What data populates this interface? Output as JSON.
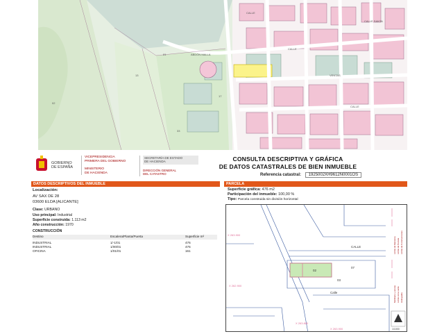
{
  "map": {
    "street_labels": [
      "CALLE",
      "CALLE",
      "CALLE",
      "ABDÓN MALLA",
      "CALLE",
      "CALLE",
      "CALLE",
      "VENTAS",
      "CALLE",
      "CALLE",
      "CALLE",
      "CALLE",
      "CALLE SANTA",
      "CALLE"
    ],
    "parcel_numbers": [
      "02",
      "01",
      "13",
      "17",
      "33",
      "20",
      "83",
      "22",
      "07",
      "15",
      "01",
      "12",
      "10",
      "05",
      "06"
    ],
    "colors": {
      "urban": "#f0c6d6",
      "rustic": "#d7e8cd",
      "building": "#c8dcd4",
      "highlight": "#fbf38a",
      "road": "#ffffff",
      "border": "#8a5a8a"
    }
  },
  "header": {
    "logo_text": [
      "GOBIERNO",
      "DE ESPAÑA"
    ],
    "ministry_1": [
      "VICEPRESIDENCIA",
      "PRIMERA DEL GOBIERNO"
    ],
    "ministry_2": [
      "MINISTERIO",
      "DE HACIENDA"
    ],
    "secretaria_1": [
      "SECRETARÍA DE ESTADO",
      "DE HACIENDA"
    ],
    "secretaria_2": [
      "DIRECCIÓN GENERAL",
      "DEL CATASTRO"
    ],
    "title_line_1": "CONSULTA DESCRIPTIVA Y GRÁFICA",
    "title_line_2": "DE DATOS CATASTRALES DE BIEN INMUEBLE",
    "ref_label": "Referencia catastral:",
    "ref_value": "1925002XH9612N0001OS"
  },
  "left_section": {
    "bar_title": "DATOS DESCRIPTIVOS DEL INMUEBLE",
    "localizacion_label": "Localización:",
    "address_1": "AV SAX DE 28",
    "address_2": "03600 ELDA [ALICANTE]",
    "clase_label": "Clase:",
    "clase_value": "URBANO",
    "uso_label": "Uso principal:",
    "uso_value": "Industrial",
    "superficie_label": "Superficie construida:",
    "superficie_value": "1.113 m2",
    "anio_label": "Año construcción:",
    "anio_value": "1970",
    "construccion_title": "CONSTRUCCIÓN",
    "table_headers": [
      "Destino",
      "Escalera/Planta/Puerta",
      "Superficie m²"
    ],
    "table_rows": [
      [
        "INDUSTRIAL",
        "1/-1/01",
        "476"
      ],
      [
        "INDUSTRIAL",
        "1/00/01",
        "476"
      ],
      [
        "OFICINA",
        "1/01/01",
        "161"
      ]
    ]
  },
  "right_section": {
    "bar_title": "PARCELA",
    "superficie_grafica_label": "Superficie gráfica:",
    "superficie_grafica_value": "476 m2",
    "participacion_label": "Participación del inmueble:",
    "participacion_value": "100,00 %",
    "tipo_label": "Tipo:",
    "tipo_value": "Parcela construida sin división horizontal"
  },
  "plan": {
    "labels": [
      "CALLE",
      "CALLE",
      "Calle",
      "AV SAX"
    ],
    "parcel_numbers": [
      "02",
      "07",
      "03",
      "01"
    ],
    "coordinates": [
      "X 263.900",
      "X 262.900",
      "X 263.800",
      "X 263.900"
    ],
    "legend_text": [
      "Límite de Manzana",
      "Límite de Parcela",
      "Límite de Construcciones",
      "Mobiliario y aceras",
      "Límite zona verde",
      "Hidrografía"
    ],
    "scale_label": "1/1000",
    "colors": {
      "parcel_fill": "#c9e9b6",
      "pink": "#e0709a",
      "blue": "#3a5aa0"
    }
  }
}
